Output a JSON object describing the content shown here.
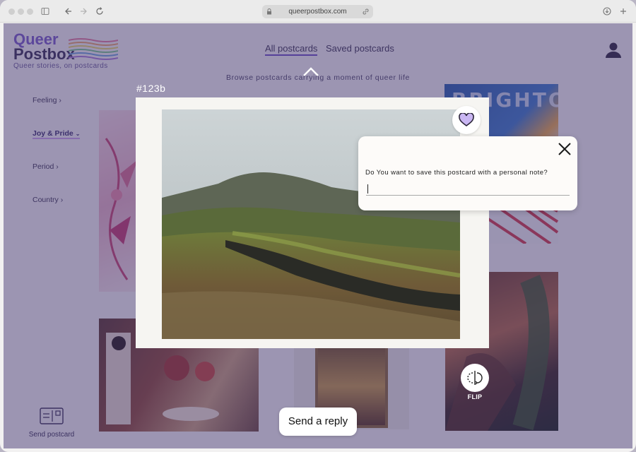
{
  "browser": {
    "url": "queerpostbox.com",
    "icons": [
      "sidebar-icon",
      "back-icon",
      "forward-icon",
      "reload-icon",
      "lock-icon",
      "link-icon",
      "download-icon",
      "new-tab-icon"
    ]
  },
  "logo": {
    "line1": "Queer",
    "line2": "Postbox",
    "tagline": "Queer stories, on postcards"
  },
  "nav": {
    "tabs": [
      {
        "label": "All postcards",
        "active": true
      },
      {
        "label": "Saved postcards",
        "active": false
      }
    ]
  },
  "subtitle": "Browse postcards carrying a moment of queer life",
  "filters": [
    {
      "label": "Feeling",
      "icon": "chevron-right-icon"
    },
    {
      "label": "Joy & Pride",
      "icon": "chevron-down-icon",
      "selected": true
    },
    {
      "label": "Period",
      "icon": "chevron-right-icon"
    },
    {
      "label": "Country",
      "icon": "chevron-right-icon"
    }
  ],
  "modal": {
    "postcard_id": "#123b",
    "note_question": "Do You want to save this postcard with a personal note?",
    "note_value": "",
    "flip_label": "FLIP",
    "reply_label": "Send a reply"
  },
  "background_card_text": "BRIGHTON",
  "footer": {
    "send_label": "Send postcard"
  },
  "colors": {
    "accent": "#6b4fc0",
    "overlay": "#3c306e",
    "heart": "#c9b6f2"
  }
}
